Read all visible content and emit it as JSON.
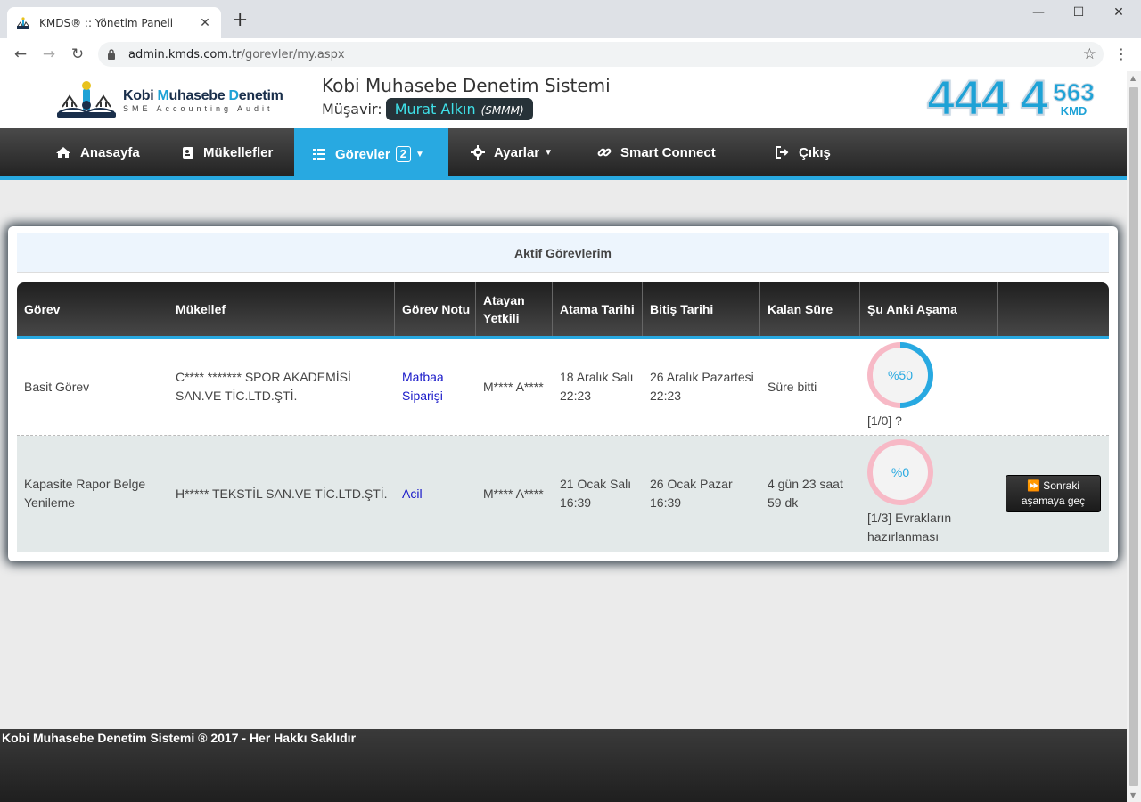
{
  "browser": {
    "tab_title": "KMDS® :: Yönetim Paneli",
    "url_host": "admin.kmds.com.tr",
    "url_path": "/gorevler/my.aspx"
  },
  "header": {
    "logo_main_1": "Kobi ",
    "logo_main_2": "M",
    "logo_main_3": "uhasebe ",
    "logo_main_4": "D",
    "logo_main_5": "enetim",
    "logo_sub": "SME Accounting Audit",
    "site_title": "Kobi Muhasebe Denetim Sistemi",
    "musavir_label": "Müşavir:",
    "musavir_name": "Murat Alkın",
    "musavir_title": "(SMMM)",
    "phone_big": "444 4",
    "phone_small": "563",
    "phone_kmd": "KMD"
  },
  "nav": {
    "home": "Anasayfa",
    "taxpayers": "Mükellefler",
    "tasks": "Görevler",
    "tasks_badge": "2",
    "settings": "Ayarlar",
    "smart": "Smart Connect",
    "logout": "Çıkış"
  },
  "card": {
    "title": "Aktif Görevlerim"
  },
  "table": {
    "headers": [
      "Görev",
      "Mükellef",
      "Görev Notu",
      "Atayan Yetkili",
      "Atama Tarihi",
      "Bitiş Tarihi",
      "Kalan Süre",
      "Şu Anki Aşama",
      ""
    ],
    "rows": [
      {
        "gorev": "Basit Görev",
        "mukellef": "C**** ******* SPOR AKADEMİSİ SAN.VE TİC.LTD.ŞTİ.",
        "not": "Matbaa Siparişi",
        "atayan": "M**** A****",
        "atama": "18 Aralık Salı 22:23",
        "bitis": "26 Aralık Pazartesi 22:23",
        "kalan": "Süre bitti",
        "progress_label": "%50",
        "progress": 0.5,
        "stage": "[1/0] ?",
        "action": ""
      },
      {
        "gorev": "Kapasite Rapor Belge Yenileme",
        "mukellef": "H***** TEKSTİL SAN.VE TİC.LTD.ŞTİ.",
        "not": "Acil",
        "atayan": "M**** A****",
        "atama": "21 Ocak Salı 16:39",
        "bitis": "26 Ocak Pazar 16:39",
        "kalan": "4 gün 23 saat 59 dk",
        "progress_label": "%0",
        "progress": 0,
        "stage": "[1/3] Evrakların hazırlanması",
        "action": "Sonraki aşamaya geç"
      }
    ]
  },
  "footer": {
    "text": "Kobi Muhasebe Denetim Sistemi ® 2017 - Her Hakkı Saklıdır"
  }
}
